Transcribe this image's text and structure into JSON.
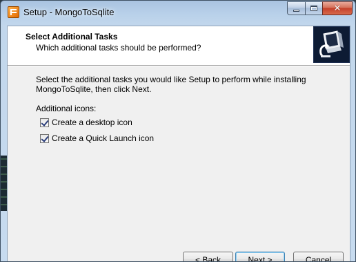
{
  "window": {
    "title": "Setup - MongoToSqlite"
  },
  "header": {
    "title": "Select Additional Tasks",
    "subtitle": "Which additional tasks should be performed?"
  },
  "body": {
    "description": "Select the additional tasks you would like Setup to perform while installing MongoToSqlite, then click Next.",
    "group_label": "Additional icons:",
    "tasks": [
      {
        "label": "Create a desktop icon",
        "checked": true
      },
      {
        "label": "Create a Quick Launch icon",
        "checked": true
      }
    ]
  },
  "buttons": {
    "back": "< Back",
    "next": "Next >",
    "cancel": "Cancel"
  }
}
